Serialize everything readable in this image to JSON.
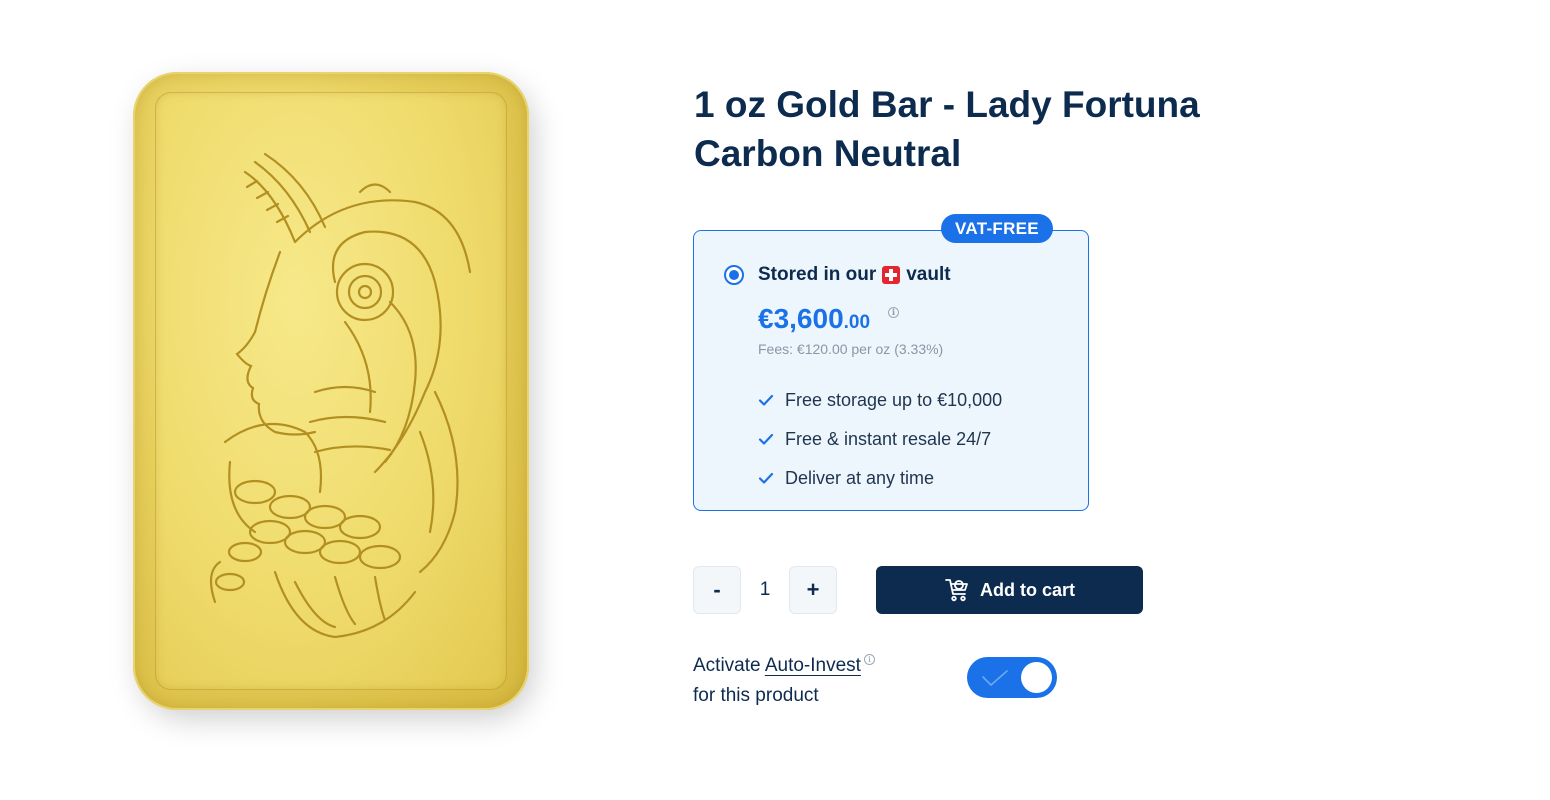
{
  "product": {
    "title_line1": "1 oz Gold Bar - Lady Fortuna",
    "title_line2": "Carbon Neutral"
  },
  "offer": {
    "badge": "VAT-FREE",
    "option_label_before": "Stored in our",
    "option_label_after": "vault",
    "price_main": "€3,600",
    "price_cents": ".00",
    "fees": "Fees: €120.00 per oz (3.33%)",
    "features": [
      "Free storage up to €10,000",
      "Free & instant resale 24/7",
      "Deliver at any time"
    ],
    "selected": true
  },
  "cart": {
    "minus_label": "-",
    "plus_label": "+",
    "quantity": "1",
    "add_label": "Add to cart"
  },
  "auto_invest": {
    "prefix": "Activate",
    "link_label": "Auto-Invest",
    "suffix": "for this product",
    "enabled": true
  },
  "colors": {
    "accent": "#1b72e8",
    "navy": "#0d2b4e",
    "panel_bg": "#eef6fd",
    "gold": "#e7cf5c"
  },
  "icons": {
    "info": "info-icon",
    "check": "check-icon",
    "cart": "cart-icon",
    "flag": "swiss-flag-icon"
  }
}
